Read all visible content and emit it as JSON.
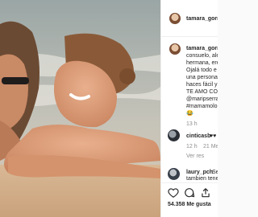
{
  "header": {
    "username": "tamara_gorr"
  },
  "caption": {
    "username": "tamara_gorr",
    "lines": [
      "consuelo, ale",
      "hermana, ere",
      "Ojalá todo e",
      "una persona",
      "haces fácil y",
      "TE AMO CON",
      "@maripserra",
      "#mamamolo",
      "😂"
    ],
    "time": "13 h"
  },
  "comments": [
    {
      "username": "cinticasb",
      "text": "♥♥",
      "time": "12 h",
      "extra": "21 Me",
      "reply": "Ver res"
    },
    {
      "username": "laury_pch",
      "text": "Se",
      "line2": "tambien tene"
    }
  ],
  "actions": {
    "like": "heart-icon",
    "comment": "comment-icon",
    "share": "share-icon"
  },
  "likes": "54.358 Me gusta"
}
